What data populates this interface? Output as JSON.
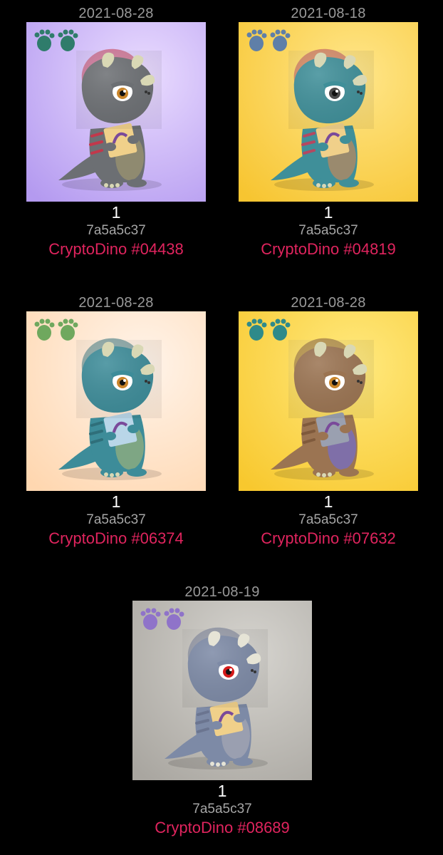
{
  "cards": [
    {
      "date": "2021-08-28",
      "quantity": "1",
      "hash": "7a5a5c37",
      "name": "CryptoDino #04438",
      "bg_from": "#eadcff",
      "bg_to": "#b49af0",
      "body": "#6c6f73",
      "belly": "#8f8a70",
      "horn": "#d9d8b5",
      "stripe": "#c2384b",
      "eye": "#c9852b",
      "feet": "#2f7c6b",
      "card_item": "#f0d08a",
      "icon": "footprint-icon"
    },
    {
      "date": "2021-08-18",
      "quantity": "1",
      "hash": "7a5a5c37",
      "name": "CryptoDino #04819",
      "bg_from": "#ffe68a",
      "bg_to": "#f7c531",
      "body": "#3f8f99",
      "belly": "#9a8a6e",
      "horn": "#d9d8b5",
      "stripe": "#b54860",
      "eye": "#4b4b4b",
      "feet": "#5f7fa8",
      "card_item": "#f0d08a",
      "icon": "footprint-icon"
    },
    {
      "date": "2021-08-28",
      "quantity": "1",
      "hash": "7a5a5c37",
      "name": "CryptoDino #06374",
      "bg_from": "#fff4ea",
      "bg_to": "#ffd7b0",
      "body": "#3d8c99",
      "belly": "#7ea684",
      "horn": "#d9d8b5",
      "stripe": "#2f6f7a",
      "eye": "#c9852b",
      "feet": "#6fa85e",
      "card_item": "#b9d6e8",
      "icon": "footprint-icon"
    },
    {
      "date": "2021-08-28",
      "quantity": "1",
      "hash": "7a5a5c37",
      "name": "CryptoDino #07632",
      "bg_from": "#ffe97e",
      "bg_to": "#f8c82e",
      "body": "#9b7452",
      "belly": "#7f6fa8",
      "horn": "#d9d8b5",
      "stripe": "#7f5a3c",
      "eye": "#c9852b",
      "feet": "#2f8a8a",
      "card_item": "#9aa0b0",
      "icon": "footprint-icon"
    },
    {
      "date": "2021-08-19",
      "quantity": "1",
      "hash": "7a5a5c37",
      "name": "CryptoDino #08689",
      "bg_from": "#d6d4cf",
      "bg_to": "#a9a6a0",
      "body": "#7d8aa6",
      "belly": "#9a9fb0",
      "horn": "#e6e4d6",
      "stripe": "#6b7590",
      "eye": "#d41a1a",
      "feet": "#8f73c9",
      "card_item": "#f0d08a",
      "icon": "footprint-icon"
    }
  ]
}
